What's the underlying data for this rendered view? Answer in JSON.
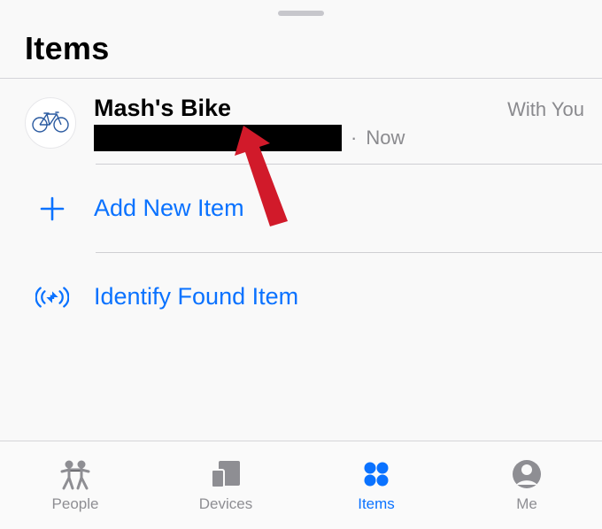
{
  "header": {
    "title": "Items"
  },
  "items": [
    {
      "name": "Mash's Bike",
      "time_separator": "·",
      "time": "Now",
      "status": "With You",
      "icon": "bicycle-icon"
    }
  ],
  "actions": {
    "add_new_item": "Add New Item",
    "identify_found_item": "Identify Found Item"
  },
  "tabbar": {
    "people": "People",
    "devices": "Devices",
    "items": "Items",
    "me": "Me",
    "active": "items"
  },
  "colors": {
    "accent": "#0a72ff",
    "muted": "#8e8e93"
  }
}
